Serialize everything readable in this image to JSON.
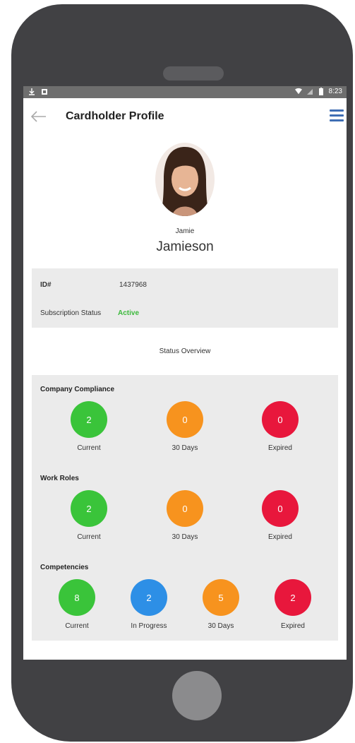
{
  "statusbar": {
    "time": "8:23"
  },
  "header": {
    "title": "Cardholder Profile"
  },
  "profile": {
    "first_name": "Jamie",
    "last_name": "Jamieson"
  },
  "info": {
    "id_label": "ID#",
    "id_value": "1437968",
    "subscription_label": "Subscription Status",
    "subscription_value": "Active"
  },
  "overview_title": "Status Overview",
  "sections": {
    "company": {
      "title": "Company Compliance",
      "items": [
        {
          "value": "2",
          "label": "Current",
          "color": "#3ac43a"
        },
        {
          "value": "0",
          "label": "30 Days",
          "color": "#f7931e"
        },
        {
          "value": "0",
          "label": "Expired",
          "color": "#e8173c"
        }
      ]
    },
    "work": {
      "title": "Work Roles",
      "items": [
        {
          "value": "2",
          "label": "Current",
          "color": "#3ac43a"
        },
        {
          "value": "0",
          "label": "30 Days",
          "color": "#f7931e"
        },
        {
          "value": "0",
          "label": "Expired",
          "color": "#e8173c"
        }
      ]
    },
    "comp": {
      "title": "Competencies",
      "items": [
        {
          "value": "8",
          "label": "Current",
          "color": "#3ac43a"
        },
        {
          "value": "2",
          "label": "In Progress",
          "color": "#2d8fe6"
        },
        {
          "value": "5",
          "label": "30 Days",
          "color": "#f7931e"
        },
        {
          "value": "2",
          "label": "Expired",
          "color": "#e8173c"
        }
      ]
    }
  }
}
